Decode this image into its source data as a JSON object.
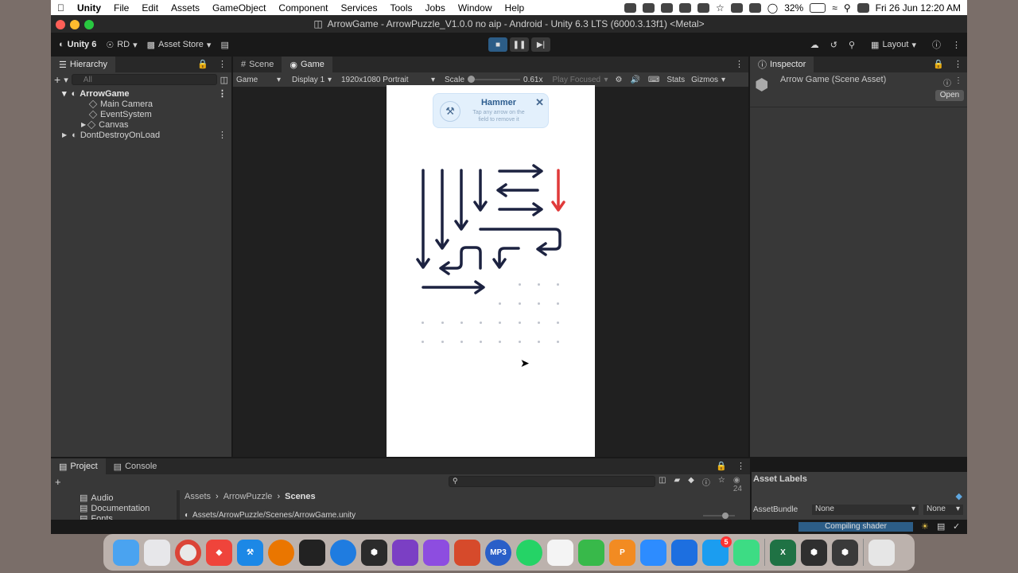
{
  "menubar": {
    "items": [
      "Unity",
      "File",
      "Edit",
      "Assets",
      "GameObject",
      "Component",
      "Services",
      "Tools",
      "Jobs",
      "Window",
      "Help"
    ],
    "battery": "32%",
    "datetime": "Fri 26 Jun  12:20 AM"
  },
  "window": {
    "title": "ArrowGame - ArrowPuzzle_V1.0.0 no aip - Android - Unity 6.3 LTS (6000.3.13f1) <Metal>"
  },
  "toolbar": {
    "unity_label": "Unity 6",
    "account": "RD",
    "asset_store": "Asset Store",
    "layout": "Layout"
  },
  "hierarchy": {
    "tab": "Hierarchy",
    "search_placeholder": "All",
    "rows": [
      "ArrowGame",
      "Main Camera",
      "EventSystem",
      "Canvas",
      "DontDestroyOnLoad"
    ]
  },
  "game": {
    "tabs": [
      "Scene",
      "Game"
    ],
    "bar": {
      "mode": "Game",
      "display": "Display 1",
      "resolution": "1920x1080 Portrait",
      "scale_label": "Scale",
      "scale_value": "0.61x",
      "play_focused": "Play Focused",
      "stats": "Stats",
      "gizmos": "Gizmos"
    },
    "hammer": {
      "title": "Hammer",
      "line1": "Tap any arrow on the",
      "line2": "field to remove it"
    }
  },
  "inspector": {
    "tab": "Inspector",
    "object": "Arrow Game (Scene Asset)",
    "open": "Open",
    "asset_labels": "Asset Labels",
    "assetbundle_label": "AssetBundle",
    "assetbundle_value": "None",
    "variant_value": "None"
  },
  "project": {
    "tabs": [
      "Project",
      "Console"
    ],
    "folders": [
      "Audio",
      "Documentation",
      "Fonts"
    ],
    "breadcrumb": [
      "Assets",
      "ArrowPuzzle",
      "Scenes"
    ],
    "path": "Assets/ArrowPuzzle/Scenes/ArrowGame.unity",
    "count": "24"
  },
  "status": {
    "compiling": "Compiling shader"
  },
  "dock": {
    "apps": [
      "Finder",
      "Launchpad",
      "Chrome",
      "AnyDesk",
      "Xcode",
      "Blender",
      "Activity Monitor",
      "Safari",
      "Unity Hub",
      "Visual Studio",
      "Visual Studio",
      "Remote Desktop",
      "MP3",
      "WhatsApp",
      "Freeform",
      "Numbers",
      "Pages",
      "Zoom",
      "Self Service",
      "App Store",
      "Android Studio",
      "Excel",
      "Unity",
      "Unity",
      "Trash"
    ],
    "badge": "5"
  },
  "colors": {
    "accent": "#2c5d87",
    "arrow": "#1c2240",
    "highlight_arrow": "#e03a3a"
  }
}
